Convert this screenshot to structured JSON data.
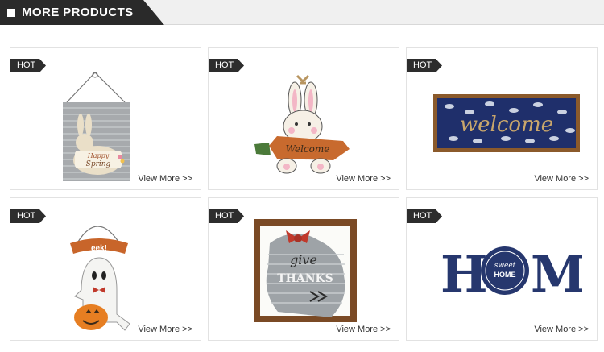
{
  "header": {
    "title": "MORE PRODUCTS"
  },
  "products": [
    {
      "badge": "HOT",
      "link": "View More >>",
      "image_text": [
        "Happy",
        "Spring"
      ]
    },
    {
      "badge": "HOT",
      "link": "View More >>",
      "image_text": [
        "Welcome"
      ]
    },
    {
      "badge": "HOT",
      "link": "View More >>",
      "image_text": [
        "welcome"
      ]
    },
    {
      "badge": "HOT",
      "link": "View More >>",
      "image_text": [
        "eek!"
      ]
    },
    {
      "badge": "HOT",
      "link": "View More >>",
      "image_text": [
        "give",
        "THANKS"
      ]
    },
    {
      "badge": "HOT",
      "link": "View More >>",
      "image_text": [
        "H",
        "sweet",
        "HOME",
        "ME"
      ]
    }
  ],
  "colors": {
    "header_dark": "#2a2a2a",
    "header_band": "#f0f0f0",
    "badge": "#2d2d2d"
  }
}
